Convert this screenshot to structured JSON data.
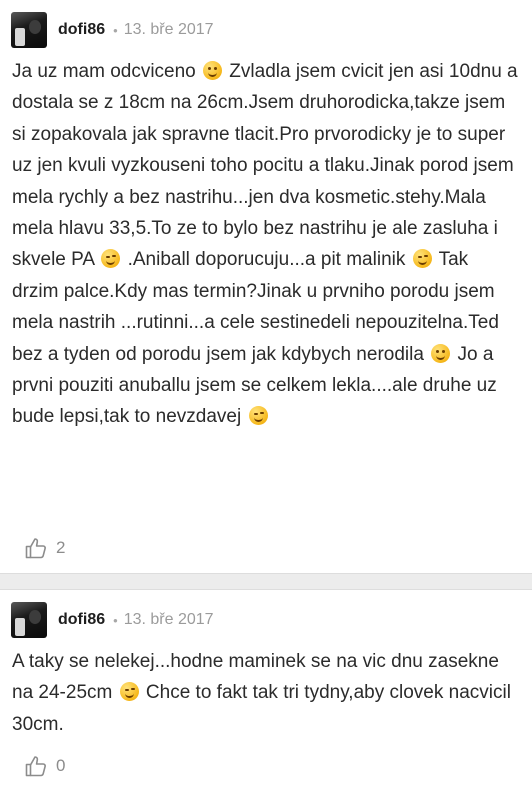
{
  "posts": [
    {
      "username": "dofi86",
      "date": "13. bře 2017",
      "segments": [
        {
          "text": "Ja uz mam odcviceno "
        },
        {
          "emoji": "smile-emoji"
        },
        {
          "text": " Zvladla jsem cvicit jen asi 10dnu a dostala se z 18cm na 26cm.Jsem druhorodicka,takze jsem si zopakovala jak spravne tlacit.Pro prvorodicky je to super uz jen kvuli vyzkouseni toho pocitu a tlaku.Jinak porod jsem mela rychly a bez nastrihu...jen dva kosmetic.stehy.Mala mela hlavu 33,5.To ze to bylo bez nastrihu je ale zasluha i skvele PA "
        },
        {
          "emoji": "wink-emoji"
        },
        {
          "text": " .Aniball doporucuju...a pit malinik "
        },
        {
          "emoji": "wink-emoji"
        },
        {
          "text": " Tak drzim palce.Kdy mas termin?Jinak u prvniho porodu jsem mela nastrih ...rutinni...a cele sestinedeli nepouzitelna.Ted bez a tyden od porodu jsem jak kdybych nerodila "
        },
        {
          "emoji": "smile-emoji"
        },
        {
          "text": " Jo a prvni pouziti anuballu jsem se celkem lekla....ale druhe uz bude lepsi,tak to nevzdavej "
        },
        {
          "emoji": "wink-emoji"
        }
      ],
      "likes": "2"
    },
    {
      "username": "dofi86",
      "date": "13. bře 2017",
      "segments": [
        {
          "text": "A taky se nelekej...hodne maminek se na vic dnu zasekne na 24-25cm "
        },
        {
          "emoji": "wink-emoji"
        },
        {
          "text": " Chce to fakt tak tri tydny,aby clovek nacvicil 30cm."
        }
      ],
      "likes": "0"
    }
  ],
  "icons": {
    "like": "thumbs-up-icon"
  }
}
